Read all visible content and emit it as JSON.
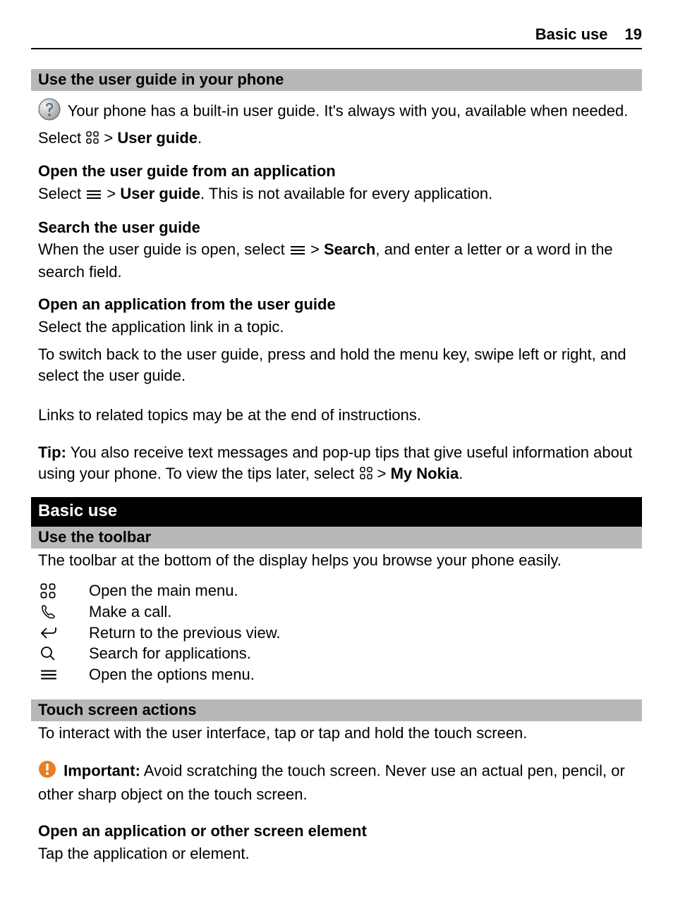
{
  "header": {
    "title": "Basic use",
    "page": "19"
  },
  "sections": {
    "s1": {
      "bar": "Use the user guide in your phone",
      "p1a": "Your phone has a built-in user guide. It's always with you, available when needed.",
      "p1b_pre": "Select ",
      "p1b_post": " > ",
      "p1b_bold": "User guide",
      "p1b_end": "."
    },
    "s2": {
      "head": "Open the user guide from an application",
      "p_pre": "Select ",
      "p_mid": " > ",
      "p_bold": "User guide",
      "p_post": ". This is not available for every application."
    },
    "s3": {
      "head": "Search the user guide",
      "p_pre": "When the user guide is open, select ",
      "p_mid": " > ",
      "p_bold": "Search",
      "p_post": ", and enter a letter or a word in the search field."
    },
    "s4": {
      "head": "Open an application from the user guide",
      "p1": "Select the application link in a topic.",
      "p2": "To switch back to the user guide, press and hold the menu key, swipe left or right, and select the user guide."
    },
    "s5": {
      "p": "Links to related topics may be at the end of instructions."
    },
    "tip": {
      "label": "Tip:",
      "p_pre": " You also receive text messages and pop-up tips that give useful information about using your phone. To view the tips later, select ",
      "p_mid": " > ",
      "p_bold": "My Nokia",
      "p_end": "."
    },
    "black": "Basic use",
    "toolbar": {
      "bar": "Use the toolbar",
      "intro": "The toolbar at the bottom of the display helps you browse your phone easily.",
      "items": [
        {
          "label": "Open the main menu."
        },
        {
          "label": "Make a call."
        },
        {
          "label": "Return to the previous view."
        },
        {
          "label": "Search for applications."
        },
        {
          "label": "Open the options menu."
        }
      ]
    },
    "touch": {
      "bar": "Touch screen actions",
      "intro": "To interact with the user interface, tap or tap and hold the touch screen.",
      "imp_label": "Important:",
      "imp_text": " Avoid scratching the touch screen. Never use an actual pen, pencil, or other sharp object on the touch screen."
    },
    "open_app": {
      "head": "Open an application or other screen element",
      "p": "Tap the application or element."
    }
  }
}
